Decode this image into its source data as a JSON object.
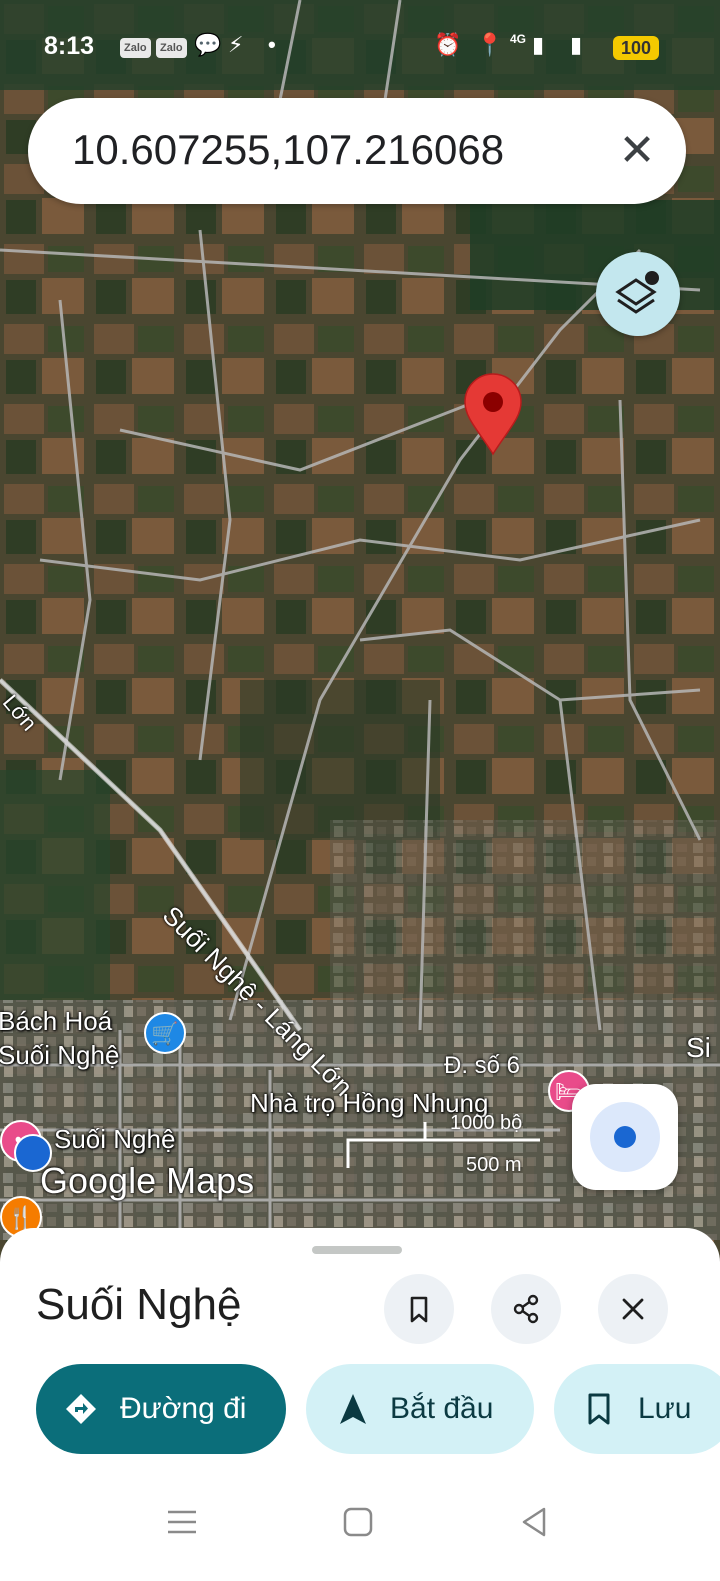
{
  "status_bar": {
    "time": "8:13",
    "apps": [
      "Zalo",
      "Zalo"
    ],
    "network": "4G",
    "battery": "100"
  },
  "search": {
    "query": "10.607255,107.216068"
  },
  "map": {
    "labels": {
      "bach_hoa": "Bách Hoá\nSuối Nghệ",
      "bach_hoa_line1": "Bách Hoá",
      "bach_hoa_line2": "Suối Nghệ",
      "suoi_nghe": "Suối Nghệ",
      "nha_tro": "Nhà trọ Hồng Nhung",
      "road_ds6": "Đ. số 6",
      "road_snll": "Suối Nghệ - Láng Lớn",
      "road_lon": "Lớn",
      "edge_si": "Si"
    },
    "scale": {
      "imperial": "1000 bộ",
      "metric": "500 m"
    },
    "brand": "Google Maps",
    "colors": {
      "pin": "#e53935",
      "locate_dot": "#1a67d2",
      "layers_bg": "#c3e7ee"
    }
  },
  "sheet": {
    "place_name": "Suối Nghệ",
    "actions": {
      "directions": "Đường đi",
      "start": "Bắt đầu",
      "save": "Lưu"
    },
    "colors": {
      "primary": "#0b6e7a",
      "secondary": "#d3f1f6"
    }
  }
}
